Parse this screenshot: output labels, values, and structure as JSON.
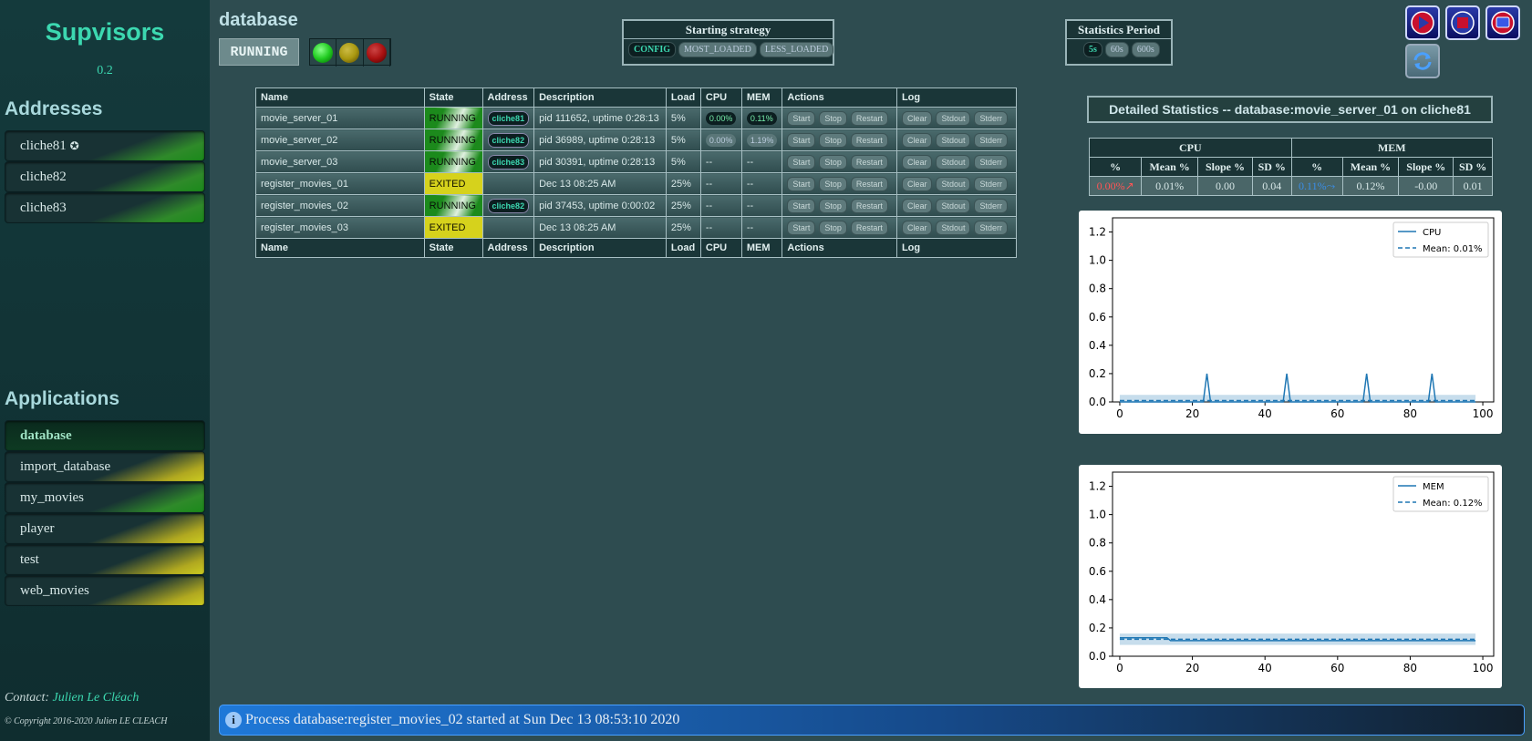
{
  "sidebar": {
    "title": "Supvisors",
    "version": "0.2",
    "addresses_heading": "Addresses",
    "addresses": [
      {
        "label": "cliche81",
        "icon": "gear-icon",
        "local": true,
        "state": "green"
      },
      {
        "label": "cliche82",
        "state": "green"
      },
      {
        "label": "cliche83",
        "state": "green"
      }
    ],
    "applications_heading": "Applications",
    "applications": [
      {
        "label": "database",
        "state": "active"
      },
      {
        "label": "import_database",
        "state": "yellow"
      },
      {
        "label": "my_movies",
        "state": "green"
      },
      {
        "label": "player",
        "state": "yellow"
      },
      {
        "label": "test",
        "state": "yellow"
      },
      {
        "label": "web_movies",
        "state": "yellow"
      }
    ],
    "contact_label": "Contact:",
    "contact_name": "Julien Le Cléach",
    "copyright": "© Copyright 2016-2020 Julien LE CLEACH"
  },
  "header": {
    "app_name": "database",
    "app_state": "RUNNING",
    "lights": [
      {
        "name": "green-light",
        "color": "#22cc22",
        "active": true
      },
      {
        "name": "yellow-light",
        "color": "#aa9a10",
        "active": false
      },
      {
        "name": "red-light",
        "color": "#aa1010",
        "active": false
      }
    ],
    "strategy": {
      "title": "Starting strategy",
      "options": [
        {
          "label": "CONFIG",
          "selected": true
        },
        {
          "label": "MOST_LOADED",
          "selected": false
        },
        {
          "label": "LESS_LOADED",
          "selected": false
        }
      ]
    },
    "period": {
      "title": "Statistics Period",
      "options": [
        {
          "label": "5s",
          "selected": true
        },
        {
          "label": "60s",
          "selected": false
        },
        {
          "label": "600s",
          "selected": false
        }
      ]
    },
    "controls": [
      "restart-icon",
      "shutdown-icon",
      "video-icon",
      "refresh-icon"
    ]
  },
  "process_table": {
    "headers": [
      "Name",
      "State",
      "Address",
      "Description",
      "Load",
      "CPU",
      "MEM",
      "Actions",
      "Log"
    ],
    "actions": [
      "Start",
      "Stop",
      "Restart"
    ],
    "logs": [
      "Clear",
      "Stdout",
      "Stderr"
    ],
    "rows": [
      {
        "name": "movie_server_01",
        "state": "RUNNING",
        "address": "cliche81",
        "description": "pid 111652, uptime 0:28:13",
        "load": "5%",
        "cpu": "0.00%",
        "mem": "0.11%",
        "cpu_active": true
      },
      {
        "name": "movie_server_02",
        "state": "RUNNING",
        "address": "cliche82",
        "description": "pid 36989, uptime 0:28:13",
        "load": "5%",
        "cpu": "0.00%",
        "mem": "1.19%",
        "cpu_active": false
      },
      {
        "name": "movie_server_03",
        "state": "RUNNING",
        "address": "cliche83",
        "description": "pid 30391, uptime 0:28:13",
        "load": "5%",
        "cpu": "--",
        "mem": "--"
      },
      {
        "name": "register_movies_01",
        "state": "EXITED",
        "address": "",
        "description": "Dec 13 08:25 AM",
        "load": "25%",
        "cpu": "--",
        "mem": "--"
      },
      {
        "name": "register_movies_02",
        "state": "RUNNING",
        "address": "cliche82",
        "description": "pid 37453, uptime 0:00:02",
        "load": "25%",
        "cpu": "--",
        "mem": "--"
      },
      {
        "name": "register_movies_03",
        "state": "EXITED",
        "address": "",
        "description": "Dec 13 08:25 AM",
        "load": "25%",
        "cpu": "--",
        "mem": "--"
      }
    ]
  },
  "details": {
    "title": "Detailed Statistics -- database:movie_server_01 on cliche81",
    "groups": [
      "CPU",
      "MEM"
    ],
    "subheaders": [
      "%",
      "Mean %",
      "Slope %",
      "SD %",
      "%",
      "Mean %",
      "Slope %",
      "SD %"
    ],
    "values": [
      "0.00%↗",
      "0.01%",
      "0.00",
      "0.04",
      "0.11%⤳",
      "0.12%",
      "-0.00",
      "0.01"
    ],
    "value_colors": [
      "#ff5555",
      "",
      "",
      "",
      "#3a8ee8",
      "",
      "",
      ""
    ]
  },
  "chart_data": [
    {
      "type": "line",
      "x": [
        0,
        23,
        24,
        25,
        45,
        46,
        47,
        67,
        68,
        69,
        85,
        86,
        87,
        98
      ],
      "series": [
        {
          "name": "CPU",
          "values": [
            0,
            0,
            0.2,
            0,
            0,
            0.2,
            0,
            0,
            0.2,
            0,
            0,
            0.2,
            0,
            0
          ]
        },
        {
          "name": "Mean: 0.01%",
          "values": [
            0.01,
            0.01,
            0.01,
            0.01,
            0.01,
            0.01,
            0.01,
            0.01,
            0.01,
            0.01,
            0.01,
            0.01,
            0.01,
            0.01
          ]
        }
      ],
      "xlim": [
        -2,
        103
      ],
      "ylim": [
        0,
        1.3
      ],
      "xticks": [
        0,
        20,
        40,
        60,
        80,
        100
      ],
      "yticks": [
        "0.0",
        "0.2",
        "0.4",
        "0.6",
        "0.8",
        "1.0",
        "1.2"
      ],
      "legend": "top-right"
    },
    {
      "type": "line",
      "x": [
        0,
        13,
        14,
        98
      ],
      "series": [
        {
          "name": "MEM",
          "values": [
            0.13,
            0.13,
            0.11,
            0.11
          ]
        },
        {
          "name": "Mean: 0.12%",
          "values": [
            0.12,
            0.12,
            0.12,
            0.12
          ]
        }
      ],
      "xlim": [
        -2,
        103
      ],
      "ylim": [
        0,
        1.3
      ],
      "xticks": [
        0,
        20,
        40,
        60,
        80,
        100
      ],
      "yticks": [
        "0.0",
        "0.2",
        "0.4",
        "0.6",
        "0.8",
        "1.0",
        "1.2"
      ],
      "legend": "top-right"
    }
  ],
  "message": {
    "icon": "info-icon",
    "text": "Process database:register_movies_02 started at Sun Dec 13 08:53:10 2020"
  }
}
